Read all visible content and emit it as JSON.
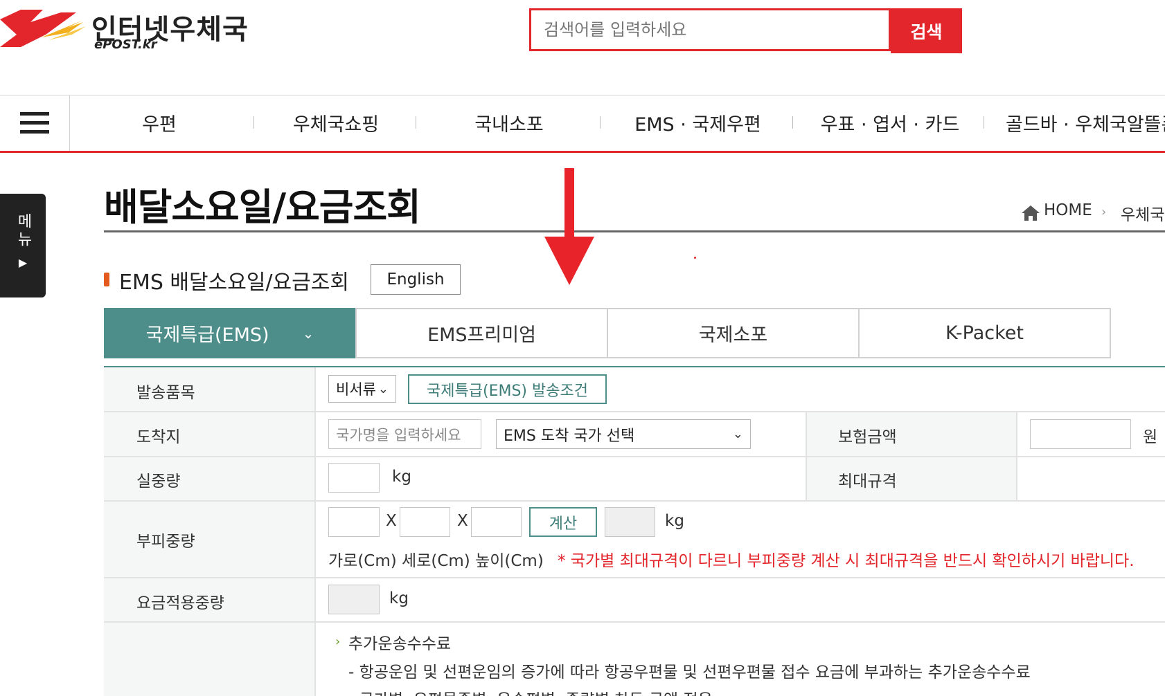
{
  "header": {
    "logo_text": "인터넷우체국",
    "logo_sub": "ePOST.kr",
    "search_placeholder": "검색어를 입력하세요",
    "search_button": "검색"
  },
  "nav": {
    "items": [
      "우편",
      "우체국쇼핑",
      "국내소포",
      "EMS · 국제우편",
      "우표 · 엽서 · 카드",
      "골드바 · 우체국알뜰폰"
    ]
  },
  "side_menu": {
    "label": "메뉴"
  },
  "page": {
    "title": "배달소요일/요금조회",
    "breadcrumb_home": "HOME",
    "breadcrumb_next": "우체국",
    "subtitle": "EMS 배달소요일/요금조회",
    "english_button": "English"
  },
  "tabs": [
    "국제특급(EMS)",
    "EMS프리미엄",
    "국제소포",
    "K-Packet"
  ],
  "form": {
    "item_label": "발송품목",
    "item_select": "비서류",
    "item_conditions_button": "국제특급(EMS) 발송조건",
    "dest_label": "도착지",
    "dest_placeholder": "국가명을 입력하세요",
    "dest_select": "EMS 도착 국가 선택",
    "insurance_label": "보험금액",
    "insurance_unit": "원",
    "weight_label": "실중량",
    "weight_unit": "kg",
    "max_size_label": "최대규격",
    "volume_label": "부피중량",
    "x_sep": "X",
    "calc_button": "계산",
    "volume_unit": "kg",
    "dims_caption": "가로(Cm) 세로(Cm) 높이(Cm)",
    "dims_warning": "* 국가별 최대규격이 다르니 부피중량 계산 시 최대규격을 반드시 확인하시기 바랍니다.",
    "applied_label": "요금적용중량",
    "applied_unit": "kg",
    "surcharge_title": "추가운송수수료",
    "surcharge_line1": "- 항공운임 및 선편운임의 증가에 따라 항공우편물 및 선편우편물 접수 요금에 부과하는 추가운송수수료",
    "surcharge_line2": "- 국가별, 우편물종별, 운송편별, 중량별 차등 금액 적용"
  },
  "colors": {
    "brand_red": "#e3262b",
    "teal": "#4e8e8a",
    "arrow_red": "#e8242a"
  }
}
